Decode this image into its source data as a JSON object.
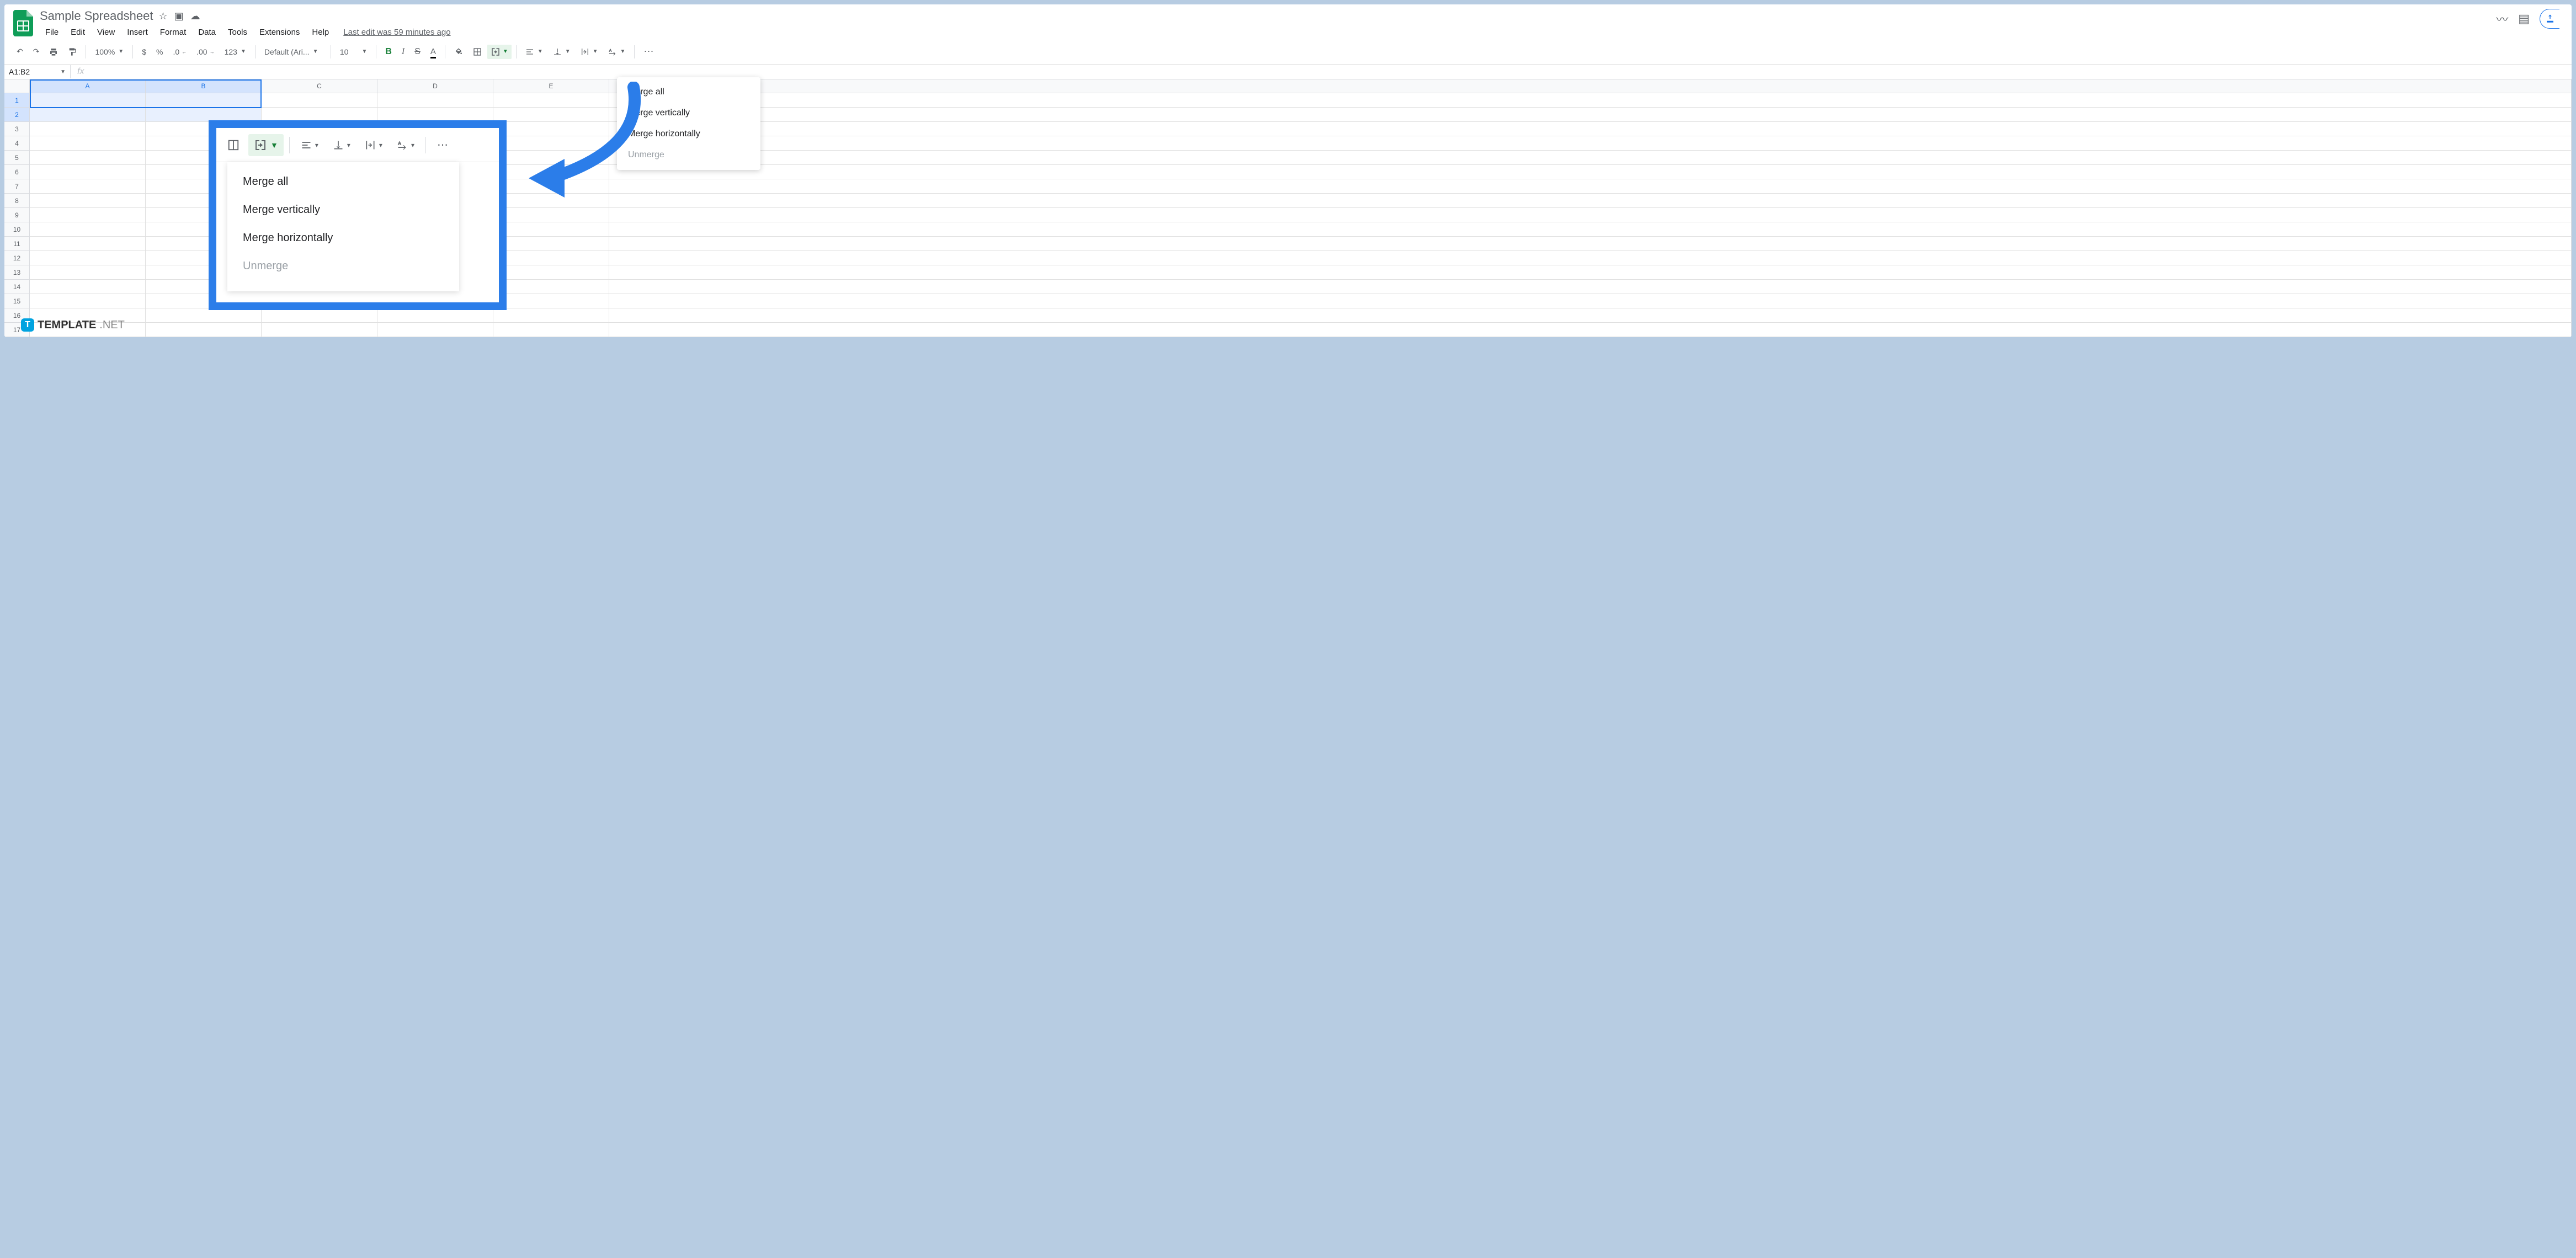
{
  "doc": {
    "title": "Sample Spreadsheet"
  },
  "menu": {
    "file": "File",
    "edit": "Edit",
    "view": "View",
    "insert": "Insert",
    "format": "Format",
    "data": "Data",
    "tools": "Tools",
    "extensions": "Extensions",
    "help": "Help",
    "last_edit": "Last edit was 59 minutes ago"
  },
  "toolbar": {
    "zoom": "100%",
    "currency": "$",
    "percent": "%",
    "dec_dec": ".0",
    "inc_dec": ".00",
    "format_num": "123",
    "font": "Default (Ari...",
    "font_size": "10",
    "bold": "B",
    "italic": "I",
    "strike": "S",
    "text_color": "A",
    "more": "⋯"
  },
  "formula": {
    "name_box": "A1:B2",
    "fx": "fx"
  },
  "columns": [
    "A",
    "B",
    "C",
    "D",
    "E"
  ],
  "rows": [
    "1",
    "2",
    "3",
    "4",
    "5",
    "6",
    "7",
    "8",
    "9",
    "10",
    "11",
    "12",
    "13",
    "14",
    "15",
    "16",
    "17"
  ],
  "selected_cols": [
    "A",
    "B"
  ],
  "selected_rows": [
    "1",
    "2"
  ],
  "merge_menu": {
    "merge_all": "Merge all",
    "merge_vertically": "Merge vertically",
    "merge_horizontally": "Merge horizontally",
    "unmerge": "Unmerge"
  },
  "watermark": {
    "brand": "TEMPLATE",
    "suffix": ".NET"
  }
}
